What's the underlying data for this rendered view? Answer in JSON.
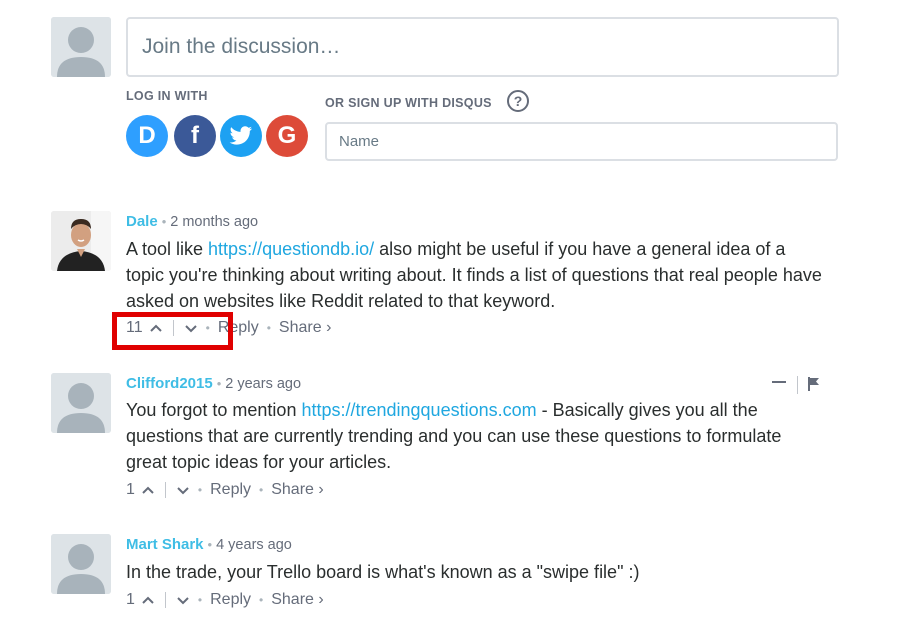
{
  "compose": {
    "placeholder": "Join the discussion…",
    "login_label": "LOG IN WITH",
    "signup_label": "OR SIGN UP WITH DISQUS",
    "help_glyph": "?",
    "name_placeholder": "Name",
    "social": [
      {
        "name": "disqus",
        "glyph": "D",
        "color": "#2e9fff"
      },
      {
        "name": "facebook",
        "glyph": "f",
        "color": "#3b5998"
      },
      {
        "name": "twitter",
        "glyph": "t",
        "color": "#1da1f2"
      },
      {
        "name": "google",
        "glyph": "G",
        "color": "#dd4b39"
      }
    ]
  },
  "comments": [
    {
      "author": "Dale",
      "bullet": "•",
      "time": "2 months ago",
      "text_before": "A tool like ",
      "link": "https://questiondb.io/",
      "text_after": " also might be useful if you have a general idea of a topic you're thinking about writing about. It finds a list of questions that real people have asked on websites like Reddit related to that keyword.",
      "votes": "11",
      "reply": "Reply",
      "share": "Share ›"
    },
    {
      "author": "Clifford2015",
      "bullet": "•",
      "time": "2 years ago",
      "text_before": "You forgot to mention ",
      "link": "https://trendingquestions.com",
      "text_after": " - Basically gives you all the questions that are currently trending and you can use these questions to formulate great topic ideas for your articles.",
      "votes": "1",
      "reply": "Reply",
      "share": "Share ›"
    },
    {
      "author": "Mart Shark",
      "bullet": "•",
      "time": "4 years ago",
      "text_before": "In the trade, your Trello board is what's known as a \"swipe file\" :)",
      "link": "",
      "text_after": "",
      "votes": "1",
      "reply": "Reply",
      "share": "Share ›"
    }
  ],
  "colors": {
    "author": "#3fbde5",
    "link": "#1fa7e0",
    "highlight": "#e00000"
  }
}
